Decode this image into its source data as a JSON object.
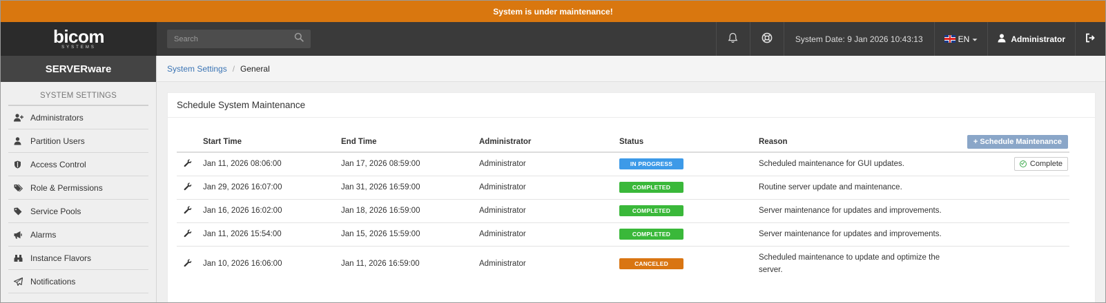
{
  "banner": {
    "text": "System is under maintenance!",
    "color": "#d9770f"
  },
  "header": {
    "logo_text": "bicom",
    "logo_subtext": "SYSTEMS",
    "search_placeholder": "Search",
    "system_date": "System Date: 9 Jan 2026 10:43:13",
    "language": "EN",
    "user": "Administrator",
    "icons": [
      "bell-icon",
      "lifebuoy-icon",
      "flag-icon",
      "user-icon",
      "logout-icon"
    ]
  },
  "sidebar": {
    "brand": "SERVERware",
    "section_title": "SYSTEM SETTINGS",
    "items": [
      {
        "label": "Administrators",
        "icon": "user-plus-icon"
      },
      {
        "label": "Partition Users",
        "icon": "user-icon"
      },
      {
        "label": "Access Control",
        "icon": "shield-icon"
      },
      {
        "label": "Role & Permissions",
        "icon": "tags-icon"
      },
      {
        "label": "Service Pools",
        "icon": "tag-icon"
      },
      {
        "label": "Alarms",
        "icon": "bullhorn-icon"
      },
      {
        "label": "Instance Flavors",
        "icon": "binoculars-icon"
      },
      {
        "label": "Notifications",
        "icon": "paper-plane-icon"
      }
    ]
  },
  "breadcrumb": {
    "parent": "System Settings",
    "current": "General"
  },
  "panel": {
    "title": "Schedule System Maintenance",
    "schedule_button": "Schedule Maintenance",
    "columns": [
      "Start Time",
      "End Time",
      "Administrator",
      "Status",
      "Reason"
    ],
    "rows": [
      {
        "start": "Jan 11, 2026 08:06:00",
        "end": "Jan 17, 2026 08:59:00",
        "admin": "Administrator",
        "status": "IN PROGRESS",
        "status_color": "#3d9ae8",
        "reason": "Scheduled maintenance for GUI updates.",
        "action": "Complete"
      },
      {
        "start": "Jan 29, 2026 16:07:00",
        "end": "Jan 31, 2026 16:59:00",
        "admin": "Administrator",
        "status": "COMPLETED",
        "status_color": "#3ab83a",
        "reason": "Routine server update and maintenance.",
        "action": ""
      },
      {
        "start": "Jan 16, 2026 16:02:00",
        "end": "Jan 18, 2026 16:59:00",
        "admin": "Administrator",
        "status": "COMPLETED",
        "status_color": "#3ab83a",
        "reason": "Server maintenance for updates and improvements.",
        "action": ""
      },
      {
        "start": "Jan 11, 2026 15:54:00",
        "end": "Jan 15, 2026 15:59:00",
        "admin": "Administrator",
        "status": "COMPLETED",
        "status_color": "#3ab83a",
        "reason": "Server maintenance for updates and improvements.",
        "action": ""
      },
      {
        "start": "Jan 10, 2026 16:06:00",
        "end": "Jan 11, 2026 16:59:00",
        "admin": "Administrator",
        "status": "CANCELED",
        "status_color": "#d97512",
        "reason": "Scheduled maintenance to update and optimize the server.",
        "action": ""
      }
    ]
  }
}
